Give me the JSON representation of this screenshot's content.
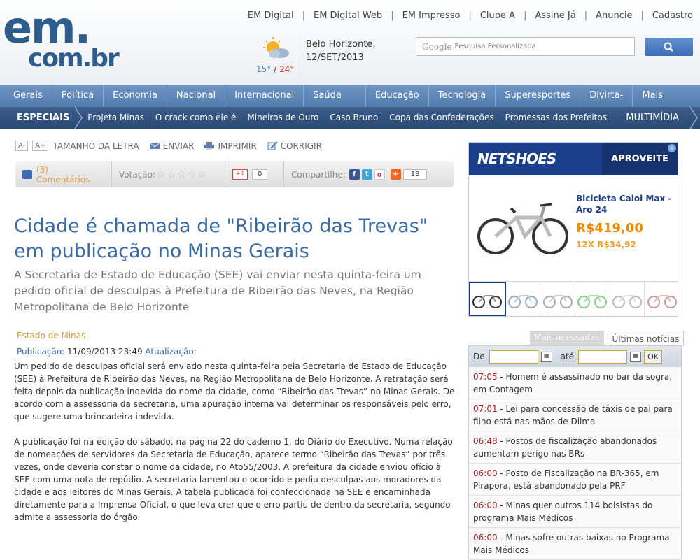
{
  "header": {
    "logo_top": "em.",
    "logo_bottom": "com.br",
    "top_links": [
      "EM Digital",
      "EM Digital Web",
      "EM Impresso",
      "Clube A",
      "Assine Já",
      "Anuncie",
      "Cadastro"
    ],
    "temp_min": "15°",
    "temp_sep": "/",
    "temp_max": "24°",
    "city": "Belo Horizonte,",
    "date": "12/SET/2013",
    "search_brand": "Google",
    "search_placeholder": "Pesquisa Personalizada"
  },
  "nav_main": [
    "Gerais",
    "Política",
    "Economia",
    "Nacional",
    "Internacional",
    "Saúde Plena",
    "Educação",
    "Tecnologia",
    "Superesportes",
    "Divirta-se",
    "Mais Seções"
  ],
  "nav_special": {
    "label": "ESPECIAIS",
    "items": [
      "Projeta Minas",
      "O crack como ele é",
      "Mineiros de Ouro",
      "Caso Bruno",
      "Copa das Confederações",
      "Promessas dos Prefeitos"
    ],
    "multimedia": "MULTIMÍDIA"
  },
  "toolbar": {
    "decrease": "A-",
    "increase": "A+",
    "font_size": "TAMANHO DA LETRA",
    "send": "ENVIAR",
    "print": "IMPRIMIR",
    "correct": "CORRIGIR"
  },
  "social": {
    "comments": "(3) Comentários",
    "vote": "Votação:",
    "gplus": "+1",
    "gplus_count": "0",
    "share": "Compartilhe:",
    "share_count": "18"
  },
  "article": {
    "title": "Cidade é chamada de \"Ribeirão das Trevas\" em publicação no Minas Gerais",
    "lead": "A Secretaria de Estado de Educação (SEE) vai enviar nesta quinta-feira um pedido oficial de desculpas à Prefeitura de Ribeirão das Neves, na Região Metropolitana de Belo Horizonte",
    "author": "Estado de Minas",
    "pub_label": "Publicação:",
    "pub_date": "11/09/2013 23:49",
    "upd_label": "Atualização:",
    "paragraphs": [
      "Um pedido de desculpas oficial será enviado nesta quinta-feira pela Secretaria de Estado de Educação (SEE) à Prefeitura de Ribeirão das Neves, na Região Metropolitana de Belo Horizonte. A retratação será feita depois da publicação indevida do nome da cidade, como “Ribeirão das Trevas” no Minas Gerais. De acordo com a assessoria da secretaria, uma apuração interna vai determinar os responsáveis pelo erro, que sugere uma brincadeira indevida.",
      "A publicação foi na edição do sábado, na página 22 do caderno 1, do Diário do Executivo. Numa relação de nomeações de servidores da Secretaria de Educação, aparece termo “Ribeirão das Trevas” por três vezes, onde deveria constar o nome da cidade, no Ato55/2003. A prefeitura da cidade enviou ofício à SEE com uma nota de repúdio. A secretaria lamentou o ocorrido e pediu desculpas aos moradores da cidade e aos leitores do Minas Gerais. A tabela publicada foi confeccionada na SEE e encaminhada diretamente para a Imprensa Oficial, o que leva crer que o erro partiu de dentro da secretaria, segundo admite a assessoria do órgão."
    ]
  },
  "ad": {
    "brand": "NETSHOES",
    "cta": "APROVEITE",
    "info": "i",
    "product": "Bicicleta Caloi Max - Aro 24",
    "price": "R$419,00",
    "installments": "12X R$34,92"
  },
  "sidebar": {
    "tab_most_read": "Mais acessadas",
    "tab_latest": "Últimas notícias",
    "from": "De",
    "to": "até",
    "ok": "OK",
    "news": [
      {
        "time": "07:05",
        "text": " - Homem é assassinado no bar da sogra, em Contagem"
      },
      {
        "time": "07:01",
        "text": " - Lei para concessão de táxis de pai para filho está nas mãos de Dilma"
      },
      {
        "time": "06:48",
        "text": " - Postos de fiscalização abandonados aumentam perigo nas BRs"
      },
      {
        "time": "06:00",
        "text": " - Posto de Fiscalização na BR-365, em Pirapora, está abandonado pela PRF"
      },
      {
        "time": "06:00",
        "text": " - Minas quer outros 114 bolsistas do programa Mais Médicos"
      },
      {
        "time": "06:00",
        "text": " - Minas sofre outras baixas no Programa Mais Médicos"
      }
    ]
  }
}
